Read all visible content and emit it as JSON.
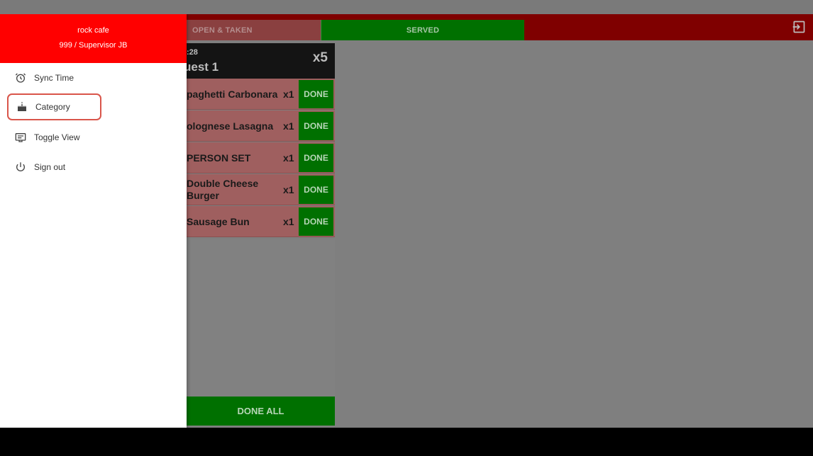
{
  "drawer": {
    "store_name": "rock cafe",
    "user_info": "999 / Supervisor JB",
    "menu": [
      {
        "label": "Sync Time",
        "icon": "alarm-clock-icon"
      },
      {
        "label": "Category",
        "icon": "cake-icon"
      },
      {
        "label": "Toggle View",
        "icon": "subtitles-icon"
      },
      {
        "label": "Sign out",
        "icon": "power-icon"
      }
    ]
  },
  "tabs": {
    "open_taken": "OPEN & TAKEN",
    "served": "SERVED"
  },
  "order": {
    "time": ":28",
    "guest": "uest 1",
    "count": "x5",
    "items": [
      {
        "name": "paghetti Carbonara",
        "qty": "x1",
        "action": "DONE"
      },
      {
        "name": "olognese Lasagna",
        "qty": "x1",
        "action": "DONE"
      },
      {
        "name": "PERSON SET",
        "qty": "x1",
        "action": "DONE"
      },
      {
        "name": "Double Cheese Burger",
        "qty": "x1",
        "action": "DONE"
      },
      {
        "name": "Sausage Bun",
        "qty": "x1",
        "action": "DONE"
      }
    ],
    "done_all": "DONE ALL"
  },
  "colors": {
    "brand_red": "#ff0000",
    "served_green": "#007000",
    "highlight": "#d9554a"
  }
}
